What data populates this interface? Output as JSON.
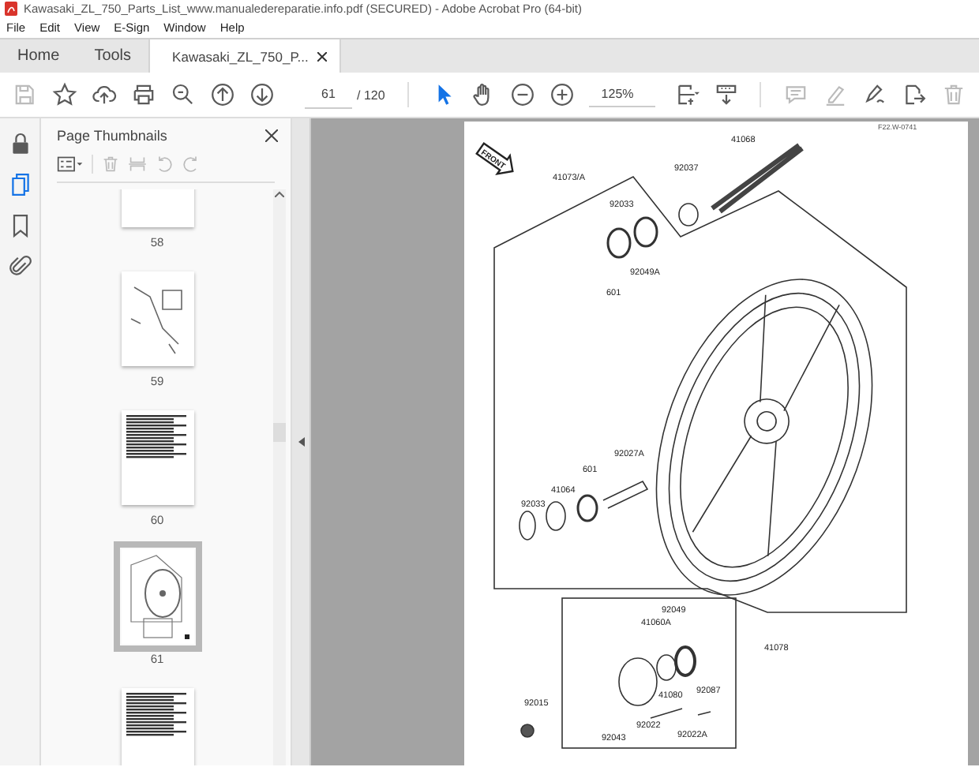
{
  "window": {
    "title": "Kawasaki_ZL_750_Parts_List_www.manualedereparatie.info.pdf (SECURED) - Adobe Acrobat Pro (64-bit)"
  },
  "menu": [
    "File",
    "Edit",
    "View",
    "E-Sign",
    "Window",
    "Help"
  ],
  "tabs": [
    {
      "label": "Home",
      "selected": false,
      "kind": "nav"
    },
    {
      "label": "Tools",
      "selected": false,
      "kind": "nav"
    },
    {
      "label": "Kawasaki_ZL_750_P...",
      "selected": true,
      "kind": "document"
    }
  ],
  "toolbar": {
    "buttons": [
      {
        "kind": "save",
        "disabled": true
      },
      {
        "kind": "star",
        "disabled": false
      },
      {
        "kind": "upload",
        "disabled": false
      },
      {
        "kind": "print",
        "disabled": false
      },
      {
        "kind": "search",
        "disabled": false
      },
      {
        "kind": "up",
        "disabled": false
      },
      {
        "kind": "down",
        "disabled": false
      }
    ],
    "page_field": {
      "value": "61"
    },
    "page_total": "/ 120",
    "tools": [
      {
        "kind": "pointer",
        "selected": true
      },
      {
        "kind": "hand",
        "selected": false
      },
      {
        "kind": "minus",
        "selected": false
      },
      {
        "kind": "plus",
        "selected": false
      }
    ],
    "zoom_field": {
      "value": "125%"
    },
    "right_buttons": [
      {
        "kind": "fit",
        "disabled": false
      },
      {
        "kind": "scroll",
        "disabled": false
      },
      {
        "kind": "comment",
        "disabled": true
      },
      {
        "kind": "highlight",
        "disabled": true
      },
      {
        "kind": "sign",
        "disabled": false
      },
      {
        "kind": "share",
        "disabled": false
      },
      {
        "kind": "trash",
        "disabled": true
      }
    ]
  },
  "rail": [
    {
      "kind": "lock",
      "selected": false
    },
    {
      "kind": "pages",
      "selected": true
    },
    {
      "kind": "bookmark",
      "selected": false
    },
    {
      "kind": "clip",
      "selected": false
    }
  ],
  "panel": {
    "title": "Page Thumbnails",
    "thumbnails": [
      {
        "label": "58",
        "kind": "list",
        "selected": false
      },
      {
        "label": "59",
        "kind": "diagram",
        "selected": false
      },
      {
        "label": "60",
        "kind": "list",
        "selected": false
      },
      {
        "label": "61",
        "kind": "wheel",
        "selected": true
      },
      {
        "kind": "list",
        "selected": false
      }
    ]
  },
  "document": {
    "code": "F22.W-0741",
    "front_label": "FRONT",
    "labels": [
      "41073/A",
      "92033",
      "92037",
      "41068",
      "601",
      "92049A",
      "92027A",
      "601",
      "41064",
      "92033",
      "92049",
      "41060A",
      "41078",
      "92015",
      "41080",
      "92087",
      "92022",
      "92043",
      "92022A"
    ]
  }
}
